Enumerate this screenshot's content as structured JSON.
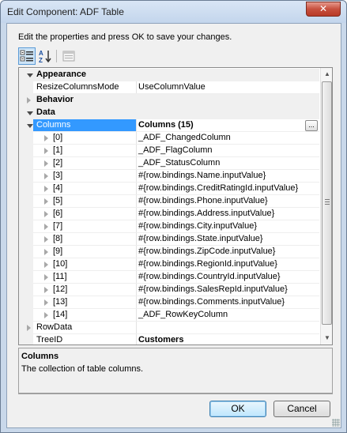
{
  "window": {
    "title": "Edit Component: ADF Table",
    "close_label": "✕"
  },
  "instructions": "Edit the properties and press OK to save your changes.",
  "grid": {
    "rows": [
      {
        "kind": "category",
        "name": "Appearance",
        "expander": "open"
      },
      {
        "kind": "property",
        "name": "ResizeColumnsMode",
        "value": "UseColumnValue"
      },
      {
        "kind": "category",
        "name": "Behavior",
        "expander": "closed"
      },
      {
        "kind": "category",
        "name": "Data",
        "expander": "open"
      },
      {
        "kind": "property",
        "name": "Columns",
        "value": "Columns (15)",
        "expander": "open",
        "selected": true,
        "value_bold": true,
        "has_ellipsis": true
      },
      {
        "kind": "child",
        "name": "[0]",
        "value": "_ADF_ChangedColumn"
      },
      {
        "kind": "child",
        "name": "[1]",
        "value": "_ADF_FlagColumn"
      },
      {
        "kind": "child",
        "name": "[2]",
        "value": "_ADF_StatusColumn"
      },
      {
        "kind": "child",
        "name": "[3]",
        "value": "#{row.bindings.Name.inputValue}"
      },
      {
        "kind": "child",
        "name": "[4]",
        "value": "#{row.bindings.CreditRatingId.inputValue}"
      },
      {
        "kind": "child",
        "name": "[5]",
        "value": "#{row.bindings.Phone.inputValue}"
      },
      {
        "kind": "child",
        "name": "[6]",
        "value": "#{row.bindings.Address.inputValue}"
      },
      {
        "kind": "child",
        "name": "[7]",
        "value": "#{row.bindings.City.inputValue}"
      },
      {
        "kind": "child",
        "name": "[8]",
        "value": "#{row.bindings.State.inputValue}"
      },
      {
        "kind": "child",
        "name": "[9]",
        "value": "#{row.bindings.ZipCode.inputValue}"
      },
      {
        "kind": "child",
        "name": "[10]",
        "value": "#{row.bindings.RegionId.inputValue}"
      },
      {
        "kind": "child",
        "name": "[11]",
        "value": "#{row.bindings.CountryId.inputValue}"
      },
      {
        "kind": "child",
        "name": "[12]",
        "value": "#{row.bindings.SalesRepId.inputValue}"
      },
      {
        "kind": "child",
        "name": "[13]",
        "value": "#{row.bindings.Comments.inputValue}"
      },
      {
        "kind": "child",
        "name": "[14]",
        "value": "_ADF_RowKeyColumn"
      },
      {
        "kind": "property",
        "name": "RowData",
        "value": "",
        "expander": "closed"
      },
      {
        "kind": "property",
        "name": "TreeID",
        "value": "Customers",
        "value_bold": true
      }
    ]
  },
  "description": {
    "title": "Columns",
    "text": "The collection of table columns."
  },
  "buttons": {
    "ok": "OK",
    "cancel": "Cancel"
  },
  "colors": {
    "selection": "#3399ff",
    "titlebar": "#c9d8ea",
    "close": "#c7503e"
  },
  "icons": {
    "categorized": "categorized-view-icon",
    "alphabetical": "alphabetical-sort-icon",
    "pages": "property-pages-icon"
  }
}
